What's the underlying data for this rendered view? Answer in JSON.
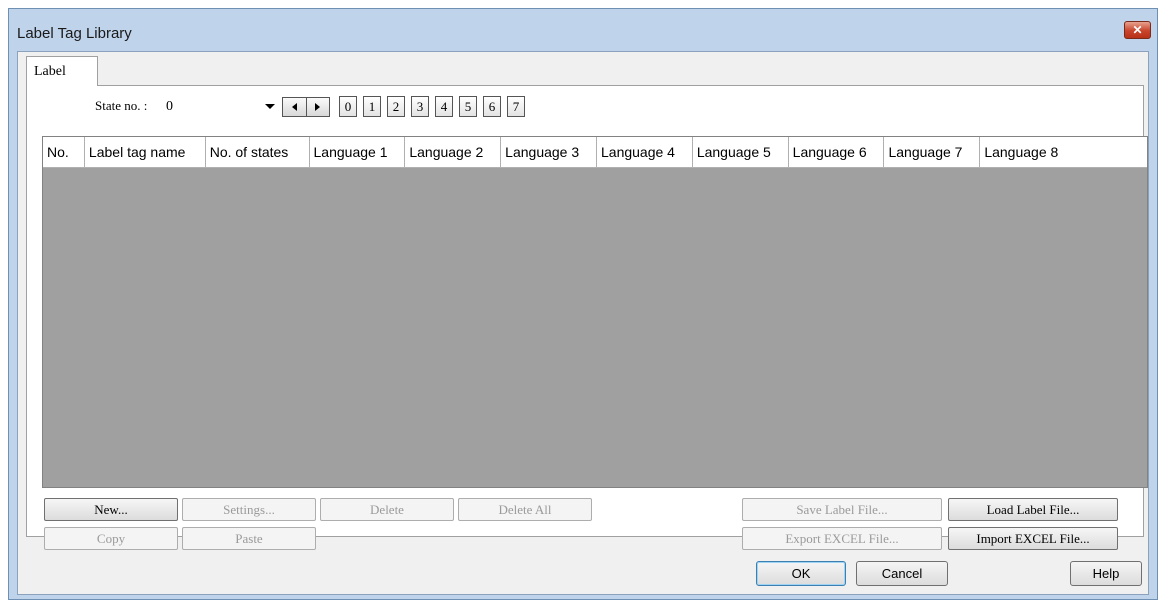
{
  "window": {
    "title": "Label Tag Library"
  },
  "tabs": [
    {
      "label": "Label"
    }
  ],
  "state": {
    "label": "State no. :",
    "value": "0",
    "buttons": [
      "0",
      "1",
      "2",
      "3",
      "4",
      "5",
      "6",
      "7"
    ]
  },
  "grid": {
    "columns": [
      "No.",
      "Label tag name",
      "No. of states",
      "Language 1",
      "Language 2",
      "Language 3",
      "Language 4",
      "Language 5",
      "Language 6",
      "Language 7",
      "Language 8"
    ],
    "rows": []
  },
  "actions": {
    "new": "New...",
    "settings": "Settings...",
    "delete": "Delete",
    "delete_all": "Delete All",
    "copy": "Copy",
    "paste": "Paste",
    "save_label_file": "Save Label File...",
    "load_label_file": "Load Label File...",
    "export_excel": "Export EXCEL File...",
    "import_excel": "Import EXCEL File..."
  },
  "footer": {
    "ok": "OK",
    "cancel": "Cancel",
    "help": "Help"
  },
  "icons": {
    "close": "close-icon",
    "prev": "arrow-left-icon",
    "next": "arrow-right-icon",
    "dropdown": "chevron-down-icon"
  }
}
